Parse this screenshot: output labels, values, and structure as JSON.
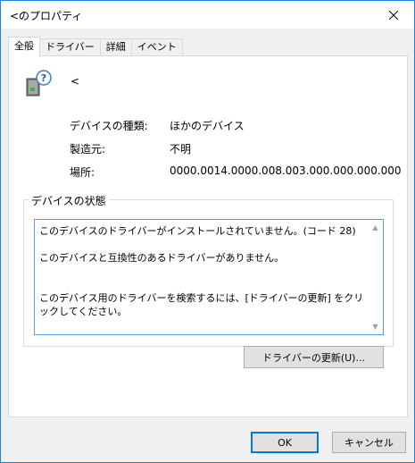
{
  "window": {
    "title": "<のプロパティ"
  },
  "tabs": [
    {
      "label": "全般"
    },
    {
      "label": "ドライバー"
    },
    {
      "label": "詳細"
    },
    {
      "label": "イベント"
    }
  ],
  "device": {
    "name": "<"
  },
  "properties": [
    {
      "label": "デバイスの種類:",
      "value": "ほかのデバイス"
    },
    {
      "label": "製造元:",
      "value": "不明"
    },
    {
      "label": "場所:",
      "value": "0000.0014.0000.008.003.000.000.000.000"
    }
  ],
  "status": {
    "legend": "デバイスの状態",
    "text": "このデバイスのドライバーがインストールされていません。(コード 28)\n\nこのデバイスと互換性のあるドライバーがありません。\n\n\nこのデバイス用のドライバーを検索するには、[ドライバーの更新] をクリックしてください。"
  },
  "buttons": {
    "update_driver": "ドライバーの更新(U)...",
    "ok": "OK",
    "cancel": "キャンセル"
  }
}
